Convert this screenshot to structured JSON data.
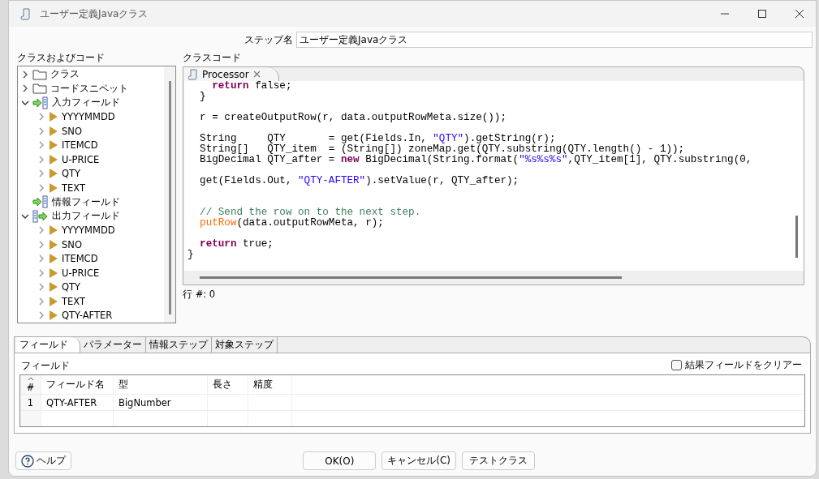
{
  "window": {
    "title": "ユーザー定義Javaクラス"
  },
  "step_name": {
    "label": "ステップ名",
    "value": "ユーザー定義Javaクラス"
  },
  "tree": {
    "label": "クラスおよびコード",
    "items": [
      {
        "kind": "folder",
        "label": "クラス",
        "expanded": false
      },
      {
        "kind": "folder",
        "label": "コードスニペット",
        "expanded": false
      },
      {
        "kind": "input",
        "label": "入力フィールド",
        "expanded": true,
        "children": [
          {
            "kind": "field",
            "label": "YYYYMMDD",
            "expanded": false
          },
          {
            "kind": "field",
            "label": "SNO",
            "expanded": false
          },
          {
            "kind": "field",
            "label": "ITEMCD",
            "expanded": false
          },
          {
            "kind": "field",
            "label": "U-PRICE",
            "expanded": false
          },
          {
            "kind": "field",
            "label": "QTY",
            "expanded": false
          },
          {
            "kind": "field",
            "label": "TEXT",
            "expanded": false
          }
        ]
      },
      {
        "kind": "info",
        "label": "情報フィールド"
      },
      {
        "kind": "output",
        "label": "出力フィールド",
        "expanded": true,
        "children": [
          {
            "kind": "field",
            "label": "YYYYMMDD",
            "expanded": false
          },
          {
            "kind": "field",
            "label": "SNO",
            "expanded": false
          },
          {
            "kind": "field",
            "label": "ITEMCD",
            "expanded": false
          },
          {
            "kind": "field",
            "label": "U-PRICE",
            "expanded": false
          },
          {
            "kind": "field",
            "label": "QTY",
            "expanded": false
          },
          {
            "kind": "field",
            "label": "TEXT",
            "expanded": false
          },
          {
            "kind": "field",
            "label": "QTY-AFTER",
            "expanded": false
          }
        ]
      }
    ]
  },
  "editor": {
    "label": "クラスコード",
    "tab": "Processor",
    "lines": [
      {
        "kind": "code",
        "tokens": [
          {
            "kind": "keyword",
            "text": "    return"
          },
          {
            "kind": "plain",
            "text": " false;"
          }
        ]
      },
      {
        "kind": "code",
        "tokens": [
          {
            "kind": "plain",
            "text": "  }"
          }
        ]
      },
      {
        "kind": "blank"
      },
      {
        "kind": "code",
        "tokens": [
          {
            "kind": "plain",
            "text": "  r = createOutputRow(r, data.outputRowMeta.size());"
          }
        ]
      },
      {
        "kind": "blank"
      },
      {
        "kind": "code",
        "tokens": [
          {
            "kind": "plain",
            "text": "  String     QTY       = get(Fields.In, "
          },
          {
            "kind": "string",
            "text": "\"QTY\""
          },
          {
            "kind": "plain",
            "text": ").getString(r);"
          }
        ]
      },
      {
        "kind": "code",
        "tokens": [
          {
            "kind": "plain",
            "text": "  String[]   QTY_item  = (String[]) zoneMap.get(QTY.substring(QTY.length() - 1));"
          }
        ]
      },
      {
        "kind": "code",
        "tokens": [
          {
            "kind": "plain",
            "text": "  BigDecimal QTY_after = "
          },
          {
            "kind": "keyword",
            "text": "new"
          },
          {
            "kind": "plain",
            "text": " BigDecimal(String.format("
          },
          {
            "kind": "string",
            "text": "\"%s%s%s\""
          },
          {
            "kind": "plain",
            "text": ",QTY_item[1], QTY.substring(0,"
          }
        ]
      },
      {
        "kind": "blank"
      },
      {
        "kind": "code",
        "tokens": [
          {
            "kind": "plain",
            "text": "  get(Fields.Out, "
          },
          {
            "kind": "string",
            "text": "\"QTY-AFTER\""
          },
          {
            "kind": "plain",
            "text": ").setValue(r, QTY_after);"
          }
        ]
      },
      {
        "kind": "blank"
      },
      {
        "kind": "blank"
      },
      {
        "kind": "code",
        "tokens": [
          {
            "kind": "comment",
            "text": "  // Send the row on to the next step."
          }
        ]
      },
      {
        "kind": "code",
        "tokens": [
          {
            "kind": "function",
            "text": "  putRow"
          },
          {
            "kind": "plain",
            "text": "(data.outputRowMeta, r);"
          }
        ]
      },
      {
        "kind": "blank"
      },
      {
        "kind": "code",
        "tokens": [
          {
            "kind": "keyword",
            "text": "  return"
          },
          {
            "kind": "plain",
            "text": " true;"
          }
        ]
      },
      {
        "kind": "code",
        "tokens": [
          {
            "kind": "plain",
            "text": "}"
          }
        ]
      }
    ],
    "position": "行 #: 0"
  },
  "tabs": [
    {
      "label": "フィールド",
      "selected": true
    },
    {
      "label": "パラメーター",
      "selected": false
    },
    {
      "label": "情報ステップ",
      "selected": false
    },
    {
      "label": "対象ステップ",
      "selected": false
    }
  ],
  "fields_panel": {
    "label": "フィールド",
    "clear_checkbox": {
      "label": "結果フィールドをクリアー",
      "checked": false
    },
    "table": {
      "columns": [
        "#",
        "フィールド名",
        "型",
        "長さ",
        "精度"
      ],
      "rows": [
        {
          "number": "1",
          "name": "QTY-AFTER",
          "type": "BigNumber"
        }
      ]
    }
  },
  "buttons": {
    "help": "ヘルプ",
    "actions": [
      "OK(O)",
      "キャンセル(C)",
      "テストクラス"
    ]
  }
}
